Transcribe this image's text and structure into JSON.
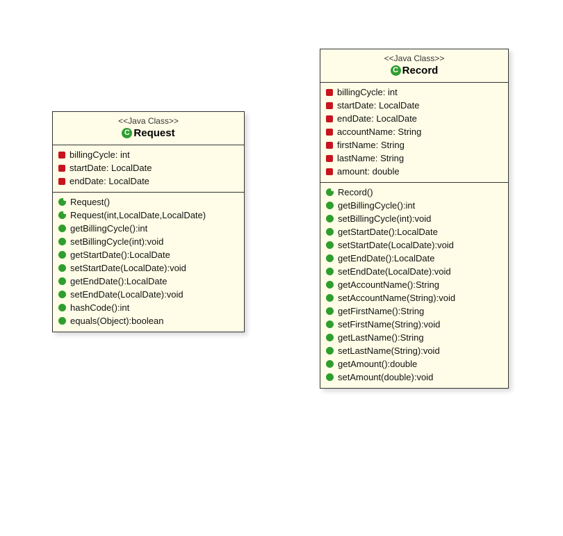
{
  "classes": {
    "request": {
      "stereotype": "<<Java Class>>",
      "name": "Request",
      "attributes": [
        "billingCycle: int",
        "startDate: LocalDate",
        "endDate: LocalDate"
      ],
      "methods": [
        {
          "kind": "ctor",
          "sig": "Request()"
        },
        {
          "kind": "ctor",
          "sig": "Request(int,LocalDate,LocalDate)"
        },
        {
          "kind": "method",
          "sig": "getBillingCycle():int"
        },
        {
          "kind": "method",
          "sig": "setBillingCycle(int):void"
        },
        {
          "kind": "method",
          "sig": "getStartDate():LocalDate"
        },
        {
          "kind": "method",
          "sig": "setStartDate(LocalDate):void"
        },
        {
          "kind": "method",
          "sig": "getEndDate():LocalDate"
        },
        {
          "kind": "method",
          "sig": "setEndDate(LocalDate):void"
        },
        {
          "kind": "method",
          "sig": "hashCode():int"
        },
        {
          "kind": "method",
          "sig": "equals(Object):boolean"
        }
      ]
    },
    "record": {
      "stereotype": "<<Java Class>>",
      "name": "Record",
      "attributes": [
        "billingCycle: int",
        "startDate: LocalDate",
        "endDate: LocalDate",
        "accountName: String",
        "firstName: String",
        "lastName: String",
        "amount: double"
      ],
      "methods": [
        {
          "kind": "ctor",
          "sig": "Record()"
        },
        {
          "kind": "method",
          "sig": "getBillingCycle():int"
        },
        {
          "kind": "method",
          "sig": "setBillingCycle(int):void"
        },
        {
          "kind": "method",
          "sig": "getStartDate():LocalDate"
        },
        {
          "kind": "method",
          "sig": "setStartDate(LocalDate):void"
        },
        {
          "kind": "method",
          "sig": "getEndDate():LocalDate"
        },
        {
          "kind": "method",
          "sig": "setEndDate(LocalDate):void"
        },
        {
          "kind": "method",
          "sig": "getAccountName():String"
        },
        {
          "kind": "method",
          "sig": "setAccountName(String):void"
        },
        {
          "kind": "method",
          "sig": "getFirstName():String"
        },
        {
          "kind": "method",
          "sig": "setFirstName(String):void"
        },
        {
          "kind": "method",
          "sig": "getLastName():String"
        },
        {
          "kind": "method",
          "sig": "setLastName(String):void"
        },
        {
          "kind": "method",
          "sig": "getAmount():double"
        },
        {
          "kind": "method",
          "sig": "setAmount(double):void"
        }
      ]
    }
  }
}
